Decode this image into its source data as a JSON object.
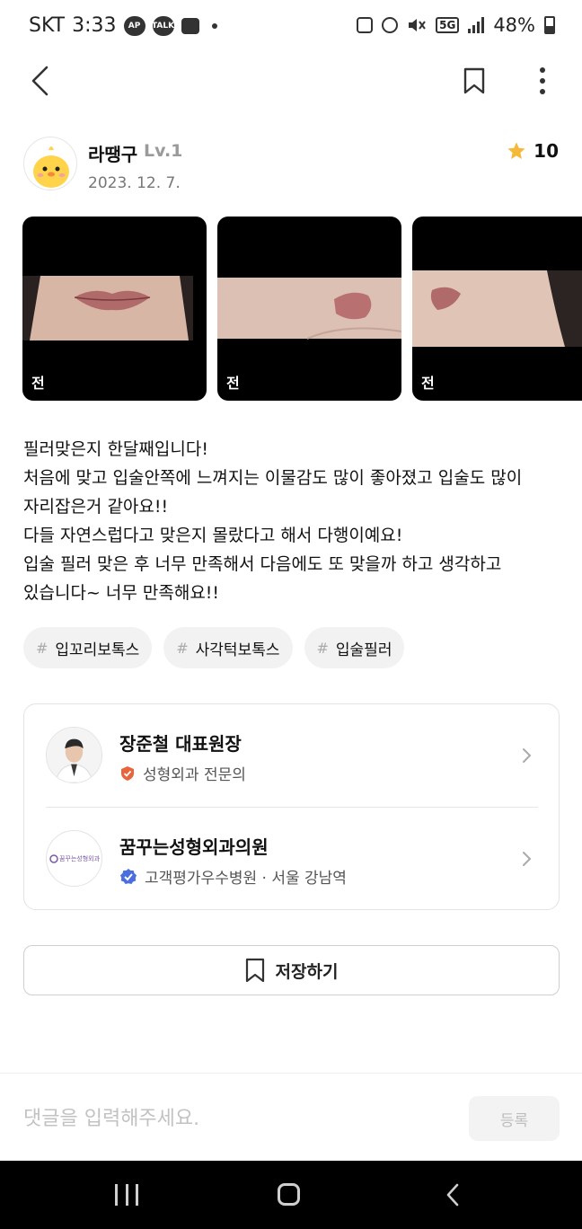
{
  "status_bar": {
    "carrier": "SKT",
    "time": "3:33",
    "badge_ap": "AP",
    "badge_talk": "TALK",
    "network": "5G",
    "battery": "48%"
  },
  "author": {
    "name": "라땡구",
    "level": "Lv.1",
    "date": "2023. 12. 7.",
    "rating": "10"
  },
  "photos": [
    {
      "label": "전"
    },
    {
      "label": "전"
    },
    {
      "label": "전"
    }
  ],
  "review": {
    "lines": [
      "필러맞은지 한달째입니다!",
      "처음에 맞고 입술안쪽에 느껴지는 이물감도 많이 좋아졌고 입술도 많이",
      "자리잡은거 같아요!!",
      "다들 자연스럽다고 맞은지 몰랐다고 해서 다행이예요!",
      "입술 필러 맞은 후 너무 만족해서 다음에도 또 맞을까 하고 생각하고",
      "있습니다~ 너무 만족해요!!"
    ]
  },
  "tags": [
    {
      "hash": "#",
      "label": "입꼬리보톡스"
    },
    {
      "hash": "#",
      "label": "사각턱보톡스"
    },
    {
      "hash": "#",
      "label": "입술필러"
    }
  ],
  "doctor": {
    "name": "장준철 대표원장",
    "specialty": "성형외과 전문의"
  },
  "hospital": {
    "name": "꿈꾸는성형외과의원",
    "logo_text": "꿈꾸는성형외과",
    "info": "고객평가우수병원 · 서울 강남역"
  },
  "save_button": {
    "label": "저장하기"
  },
  "comment": {
    "placeholder": "댓글을 입력해주세요.",
    "submit_label": "등록"
  },
  "colors": {
    "star": "#f5b93a",
    "specialist_badge": "#e8643c",
    "verified_badge": "#4a6ee0",
    "nav_bar": "#000000"
  }
}
